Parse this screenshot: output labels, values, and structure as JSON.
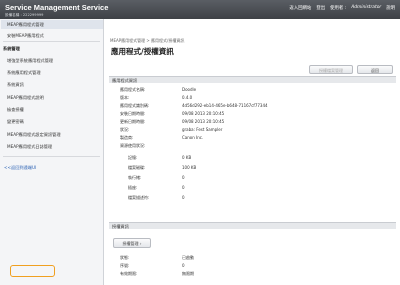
{
  "header": {
    "brand": "Service Management Service",
    "device": "設備名稱 : 222299999",
    "links": [
      "返入回網站",
      "登出",
      "使用者 :",
      "Administrator",
      "說明"
    ]
  },
  "sidebar": {
    "items": [
      {
        "label": "MEAP應用程式管理"
      },
      {
        "label": "安裝MEAP應用程式"
      },
      {
        "label": "系統管理"
      },
      {
        "label": "增強型系統應用程式管理"
      },
      {
        "label": "系統應用程式管理"
      },
      {
        "label": "系統資訊"
      },
      {
        "label": "MEAP應用程式說明"
      },
      {
        "label": "檢查授權"
      },
      {
        "label": "變更密碼"
      },
      {
        "label": "MEAP應用程式設定資訊管理"
      },
      {
        "label": "MEAP應用程式日誌管理"
      },
      {
        "label": "<<返回到遠端UI"
      }
    ]
  },
  "main": {
    "breadcrumb": "MEAP應用程式管理 > 應用程式/授權資訊",
    "title": "應用程式/授權資訊",
    "buttons": {
      "license_manage": "授權檔案管理",
      "back": "返回"
    },
    "app_section": "應用程式資訊",
    "fields": [
      {
        "label": "應用程式名稱:",
        "value": "Doodle"
      },
      {
        "label": "版本:",
        "value": "0.4.0"
      },
      {
        "label": "應用程式識別碼:",
        "value": "4d56d292-eb14-465e-b648-71167cf77344"
      },
      {
        "label": "安裝日期時間:",
        "value": "09/08 2013 20:10:45"
      },
      {
        "label": "更新日期時間:",
        "value": "09/08 2013 20:10:45"
      },
      {
        "label": "狀況:",
        "value": "graba: Fest Sampler"
      },
      {
        "label": "製造商:",
        "value": "Canon Inc."
      },
      {
        "label": "資源使用狀況:",
        "value": ""
      },
      {
        "label": "記憶:",
        "value": "0 KB"
      },
      {
        "label": "檔案磁碟:",
        "value": "100 KB"
      },
      {
        "label": "執行緒:",
        "value": "0"
      },
      {
        "label": "插座:",
        "value": "0"
      },
      {
        "label": "檔案描述符:",
        "value": "0"
      }
    ],
    "license_section": "授權資訊",
    "license_button": "授權管理",
    "license_fields": [
      {
        "label": "狀態:",
        "value": "已啟動"
      },
      {
        "label": "序號:",
        "value": "0"
      },
      {
        "label": "有效期限:",
        "value": "無限期"
      }
    ]
  }
}
